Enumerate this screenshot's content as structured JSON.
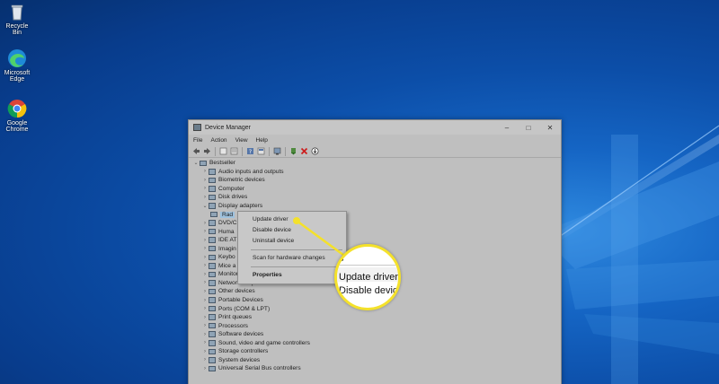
{
  "desktop": {
    "icons": [
      {
        "name": "recycle-bin",
        "label": "Recycle Bin"
      },
      {
        "name": "edge",
        "label": "Microsoft Edge"
      },
      {
        "name": "chrome",
        "label": "Google Chrome"
      }
    ]
  },
  "window": {
    "title": "Device Manager",
    "controls": {
      "minimize": "–",
      "maximize": "□",
      "close": "✕"
    },
    "menu": [
      "File",
      "Action",
      "View",
      "Help"
    ]
  },
  "tree": {
    "root": "Bestseller",
    "items": [
      "Audio inputs and outputs",
      "Biometric devices",
      "Computer",
      "Disk drives",
      "Display adapters",
      "Rad",
      "DVD/C",
      "Huma",
      "IDE AT",
      "Imagin",
      "Keybo",
      "Mice a",
      "Monitors",
      "Network adapters",
      "Other devices",
      "Portable Devices",
      "Ports (COM & LPT)",
      "Print queues",
      "Processors",
      "Software devices",
      "Sound, video and game controllers",
      "Storage controllers",
      "System devices",
      "Universal Serial Bus controllers"
    ]
  },
  "context_menu": {
    "items": [
      "Update driver",
      "Disable device",
      "Uninstall device"
    ],
    "scan": "Scan for hardware changes",
    "properties": "Properties"
  },
  "callout": {
    "partial": "s",
    "line1": "Update driver",
    "line2": "Disable devic"
  },
  "colors": {
    "callout": "#f4e12b"
  }
}
